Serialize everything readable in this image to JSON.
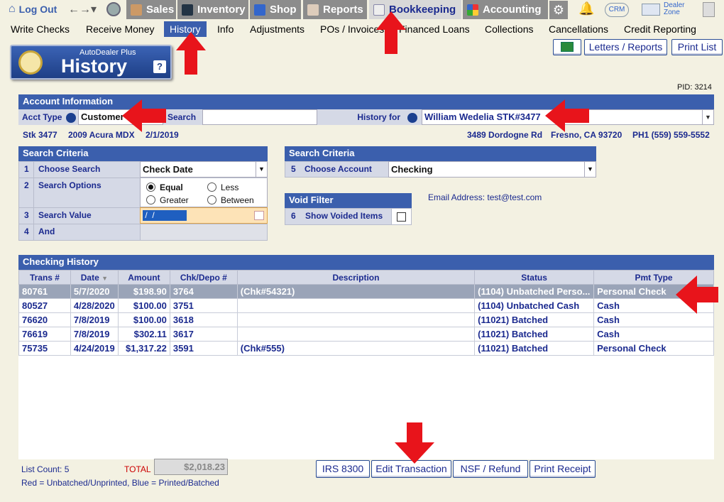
{
  "topnav": {
    "logout": "Log Out",
    "sales": "Sales",
    "inventory": "Inventory",
    "shop": "Shop",
    "reports": "Reports",
    "bookkeeping": "Bookkeeping",
    "accounting": "Accounting",
    "crm": "CRM",
    "dealer_zone": "Dealer\nZone"
  },
  "subnav": [
    "Write Checks",
    "Receive Money",
    "History",
    "Info",
    "Adjustments",
    "POs / Invoices",
    "Financed Loans",
    "Collections",
    "Cancellations",
    "Credit Reporting"
  ],
  "toolbar": {
    "letters_reports": "Letters / Reports",
    "print_list": "Print List"
  },
  "badge": {
    "subtitle": "AutoDealer Plus",
    "title": "History",
    "help": "?"
  },
  "pid": "PID: 3214",
  "account": {
    "header": "Account Information",
    "acct_type_label": "Acct Type",
    "acct_type": "Customer",
    "search_label": "Search",
    "search_value": "",
    "history_for_label": "History for",
    "history_for": "William Wedelia STK#3477",
    "stk": "Stk 3477",
    "vehicle": "2009 Acura MDX",
    "date": "2/1/2019",
    "address": "3489 Dordogne Rd",
    "city": "Fresno, CA 93720",
    "phone": "PH1 (559) 559-5552"
  },
  "search_criteria_left": {
    "header": "Search Criteria",
    "rows": [
      {
        "num": "1",
        "label": "Choose Search",
        "value": "Check Date"
      },
      {
        "num": "2",
        "label": "Search Options",
        "value": ""
      },
      {
        "num": "3",
        "label": "Search Value",
        "value": " /  / "
      },
      {
        "num": "4",
        "label": "And",
        "value": ""
      }
    ],
    "options": {
      "equal": "Equal",
      "less": "Less",
      "greater": "Greater",
      "between": "Between"
    }
  },
  "search_criteria_right": {
    "header": "Search Criteria",
    "num": "5",
    "label": "Choose Account",
    "value": "Checking"
  },
  "void_filter": {
    "header": "Void Filter",
    "num": "6",
    "label": "Show Voided Items"
  },
  "email": "Email Address: test@test.com",
  "history": {
    "header": "Checking History",
    "columns": [
      "Trans #",
      "Date",
      "Amount",
      "Chk/Depo #",
      "Description",
      "Status",
      "Pmt Type"
    ],
    "rows": [
      [
        "80761",
        "5/7/2020",
        "$198.90",
        "3764",
        "(Chk#54321)",
        "(1104) Unbatched Perso...",
        "Personal Check"
      ],
      [
        "80527",
        "4/28/2020",
        "$100.00",
        "3751",
        "",
        "(1104) Unbatched Cash",
        "Cash"
      ],
      [
        "76620",
        "7/8/2019",
        "$100.00",
        "3618",
        "",
        "(11021) Batched",
        "Cash"
      ],
      [
        "76619",
        "7/8/2019",
        "$302.11",
        "3617",
        "",
        "(11021) Batched",
        "Cash"
      ],
      [
        "75735",
        "4/24/2019",
        "$1,317.22",
        "3591",
        "(Chk#555)",
        "(11021) Batched",
        "Personal Check"
      ]
    ]
  },
  "footer": {
    "list_count": "List Count: 5",
    "total_label": "TOTAL",
    "total": "$2,018.23",
    "legend": "Red = Unbatched/Unprinted, Blue = Printed/Batched",
    "irs": "IRS 8300",
    "edit": "Edit Transaction",
    "nsf": "NSF / Refund",
    "print_receipt": "Print Receipt"
  },
  "colors": {
    "header_blue": "#3b5fad",
    "arrow_red": "#e8141b",
    "background": "#f3f1e2"
  }
}
